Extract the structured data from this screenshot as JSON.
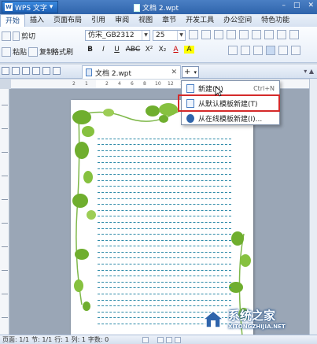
{
  "titlebar": {
    "app_name": "WPS 文字",
    "doc_title": "文档 2.wpt",
    "window_controls": [
      "–",
      "□",
      "✕"
    ]
  },
  "menubar": {
    "items": [
      "开始",
      "插入",
      "页面布局",
      "引用",
      "审阅",
      "视图",
      "章节",
      "开发工具",
      "办公空间",
      "特色功能"
    ],
    "right": [
      "ℹ",
      "?"
    ]
  },
  "ribbon": {
    "cut": "剪切",
    "paste": "粘贴",
    "copy": "复制",
    "format_painter": "格式刷",
    "font_name": "仿宋_GB2312",
    "font_size": "25",
    "format_buttons": [
      "B",
      "I",
      "U",
      "ABC",
      "X²",
      "X₂",
      "A",
      "A"
    ]
  },
  "tabbar": {
    "doc_tab": "文档 2.wpt",
    "close": "✕",
    "new_tab_plus": "+",
    "right_hint": "▾ ▲"
  },
  "ruler": {
    "labels": [
      "2",
      "1",
      "2",
      "4",
      "6",
      "8",
      "10",
      "12",
      "14",
      "16",
      "18",
      "20",
      "22"
    ]
  },
  "popup": {
    "items": [
      {
        "label": "新建(N)",
        "shortcut": "Ctrl+N"
      },
      {
        "label": "从默认模板新建(T)",
        "shortcut": ""
      },
      {
        "label": "从在线模板新建(I)...",
        "shortcut": ""
      }
    ]
  },
  "statusbar": {
    "items": [
      "页面: 1/1",
      "节: 1/1",
      "行: 1",
      "列: 1",
      "字数: 0"
    ]
  },
  "watermark": {
    "brand": "系统之家",
    "url": "XITONGZHIJIA.NET"
  },
  "colors": {
    "title_blue": "#2f64ab",
    "highlight_red": "#d42a2a",
    "dashed_line": "#2d8aa8",
    "leaf_green": "#6fae2e"
  }
}
